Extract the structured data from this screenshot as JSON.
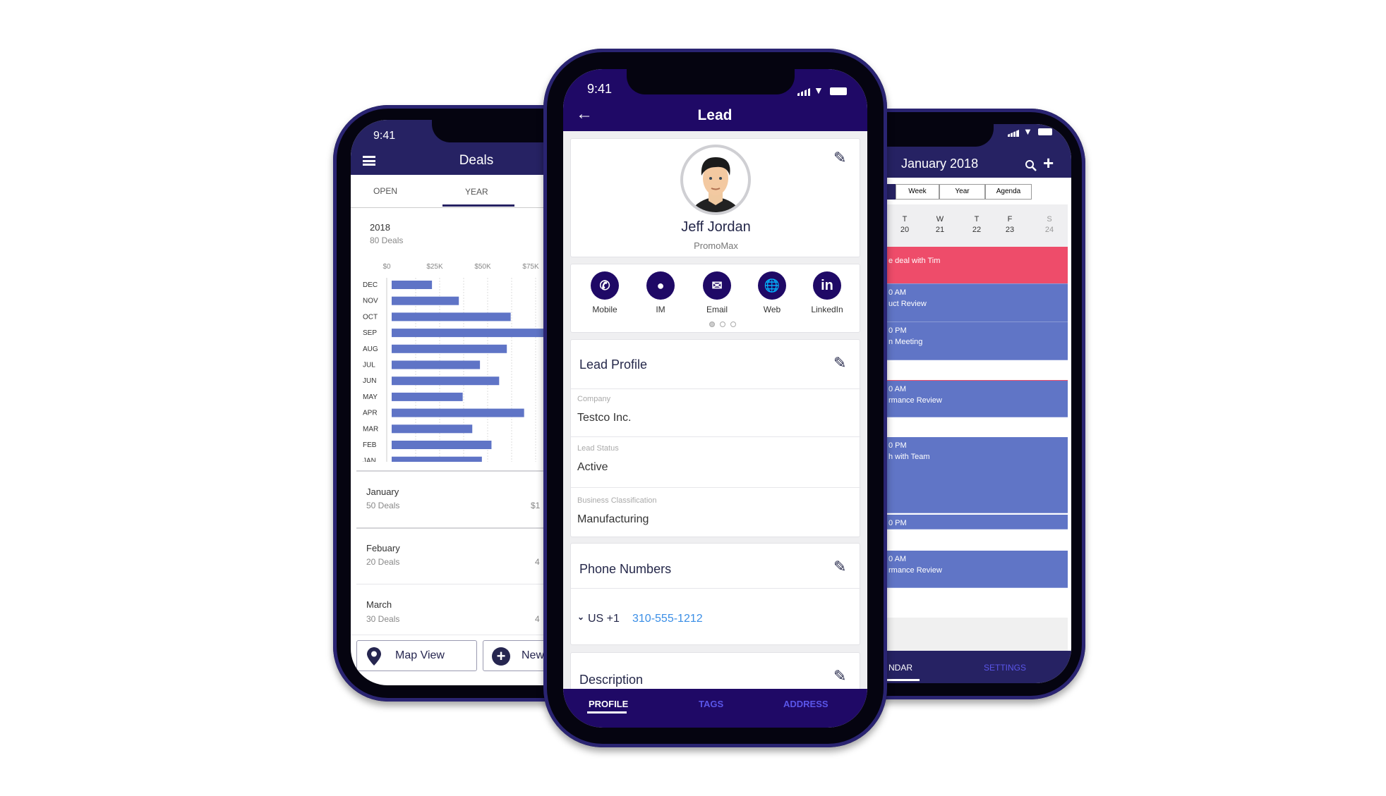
{
  "deals_phone": {
    "time": "9:41",
    "title": "Deals",
    "tabs": [
      {
        "label": "OPEN",
        "active": false
      },
      {
        "label": "YEAR",
        "active": true
      }
    ],
    "summary": {
      "year": "2018",
      "deals": "80 Deals"
    },
    "rows": [
      {
        "month": "January",
        "deals": "50 Deals",
        "amount": "$1"
      },
      {
        "month": "Febuary",
        "deals": "20 Deals",
        "amount": "4"
      },
      {
        "month": "March",
        "deals": "30 Deals",
        "amount": "4"
      }
    ],
    "buttons": {
      "map": "Map View",
      "new": "New"
    }
  },
  "chart_data": {
    "type": "bar",
    "orientation": "horizontal",
    "categories": [
      "DEC",
      "NOV",
      "OCT",
      "SEP",
      "AUG",
      "JUL",
      "JUN",
      "MAY",
      "APR",
      "MAR",
      "FEB",
      "JAN"
    ],
    "values": [
      21,
      35,
      62,
      85,
      60,
      46,
      56,
      37,
      69,
      42,
      52,
      47
    ],
    "unit": "$K",
    "xlim": [
      0,
      80
    ],
    "x_ticks": [
      "$0",
      "$25K",
      "$50K",
      "$75K"
    ],
    "grid": true,
    "bar_color": "#5f74c6"
  },
  "lead_phone": {
    "time": "9:41",
    "title": "Lead",
    "contact": {
      "name": "Jeff Jordan",
      "company": "PromoMax"
    },
    "actions": [
      {
        "label": "Mobile",
        "icon": "phone-icon"
      },
      {
        "label": "IM",
        "icon": "chat-icon"
      },
      {
        "label": "Email",
        "icon": "email-icon"
      },
      {
        "label": "Web",
        "icon": "globe-icon"
      },
      {
        "label": "LinkedIn",
        "icon": "linkedin-icon"
      }
    ],
    "page_dots": {
      "count": 3,
      "active": 1
    },
    "lead_profile": {
      "title": "Lead Profile",
      "fields": [
        {
          "label": "Company",
          "value": "Testco Inc."
        },
        {
          "label": "Lead Status",
          "value": "Active"
        },
        {
          "label": "Business Classification",
          "value": "Manufacturing"
        }
      ]
    },
    "phone_numbers": {
      "title": "Phone Numbers",
      "country": "US +1",
      "number": "310-555-1212"
    },
    "description": {
      "title": "Description"
    },
    "bottom_tabs": [
      {
        "label": "PROFILE",
        "active": true
      },
      {
        "label": "TAGS",
        "active": false
      },
      {
        "label": "ADDRESS",
        "active": false
      }
    ],
    "colors": {
      "header": "#1f0966",
      "link": "#3a8ee6",
      "inactive_tab": "#5a55e8"
    }
  },
  "calendar_phone": {
    "title": "January 2018",
    "views": [
      "Week",
      "Year",
      "Agenda"
    ],
    "days": [
      {
        "d": "T",
        "n": "20"
      },
      {
        "d": "W",
        "n": "21"
      },
      {
        "d": "T",
        "n": "22"
      },
      {
        "d": "F",
        "n": "23"
      },
      {
        "d": "S",
        "n": "24"
      }
    ],
    "events": [
      {
        "l1": "e deal with Tim",
        "l2": "",
        "color": "#ee4c6a"
      },
      {
        "l1": "0 AM",
        "l2": "uct Review",
        "color": "#6075c6"
      },
      {
        "l1": "0 PM",
        "l2": "n Meeting",
        "color": "#6075c6"
      },
      {
        "l1": "0 AM",
        "l2": "rmance Review",
        "color": "#6075c6"
      },
      {
        "l1": "0 PM",
        "l2": "h with Team",
        "color": "#6075c6"
      },
      {
        "l1": "0 PM",
        "l2": "",
        "color": "#6075c6"
      },
      {
        "l1": "0 AM",
        "l2": "rmance Review",
        "color": "#6075c6"
      }
    ],
    "bottom_tabs": [
      {
        "label": "NDAR",
        "active": true
      },
      {
        "label": "SETTINGS",
        "active": false
      }
    ]
  }
}
